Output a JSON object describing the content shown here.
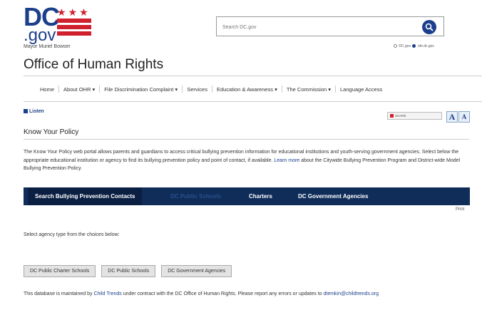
{
  "logo": {
    "dc": "DC",
    "gov": ".gov",
    "stars": "★★★"
  },
  "header": {
    "mayor": "Mayor Muriel Bowser",
    "office_title": "Office of Human Rights",
    "search_placeholder": "Search DC.gov",
    "scope_dc": "DC.gov",
    "scope_ohr": "ohr.dc.gov"
  },
  "nav": {
    "items": [
      {
        "label": "Home"
      },
      {
        "label": "About OHR ▾"
      },
      {
        "label": "File Discrimination Complaint ▾"
      },
      {
        "label": "Services"
      },
      {
        "label": "Education & Awareness ▾"
      },
      {
        "label": "The Commission ▾"
      },
      {
        "label": "Language Access"
      }
    ]
  },
  "tools": {
    "listen": "Listen",
    "share": "SHARE",
    "font_large": "A",
    "font_small": "A"
  },
  "page": {
    "heading": "Know Your Policy",
    "intro_text": "The Know Your Policy web portal allows parents and guardians to access critical bullying prevention information for educational institutions and youth-serving government agencies. Select below the appropriate educational institution or agency to find its bullying prevention policy and point of contact, if available. ",
    "intro_link": "Learn more",
    "intro_tail": " about the Citywide Bullying Prevention Program and District-wide Model Bullying Prevention Policy."
  },
  "tabs": [
    {
      "label": "Search Bullying Prevention Contacts"
    },
    {
      "label": "DC Public Schools"
    },
    {
      "label": "Charters"
    },
    {
      "label": "DC Government Agencies"
    }
  ],
  "print_label": "Print",
  "select_prompt": "Select agency type from the choices below:",
  "agency_buttons": [
    {
      "label": "DC Public Charter Schools"
    },
    {
      "label": "DC Public Schools"
    },
    {
      "label": "DC Government Agencies"
    }
  ],
  "footer": {
    "text_before": "This database is maintained by ",
    "org_link": "Child Trends",
    "text_after": " under contract with the DC Office of Human Rights. Please report any errors or updates to ",
    "email_link": "dtemkin@childtrends.org"
  },
  "colors": {
    "brand_blue": "#1b3f8b",
    "brand_red": "#d0202e",
    "tabbar": "#102d5a"
  }
}
